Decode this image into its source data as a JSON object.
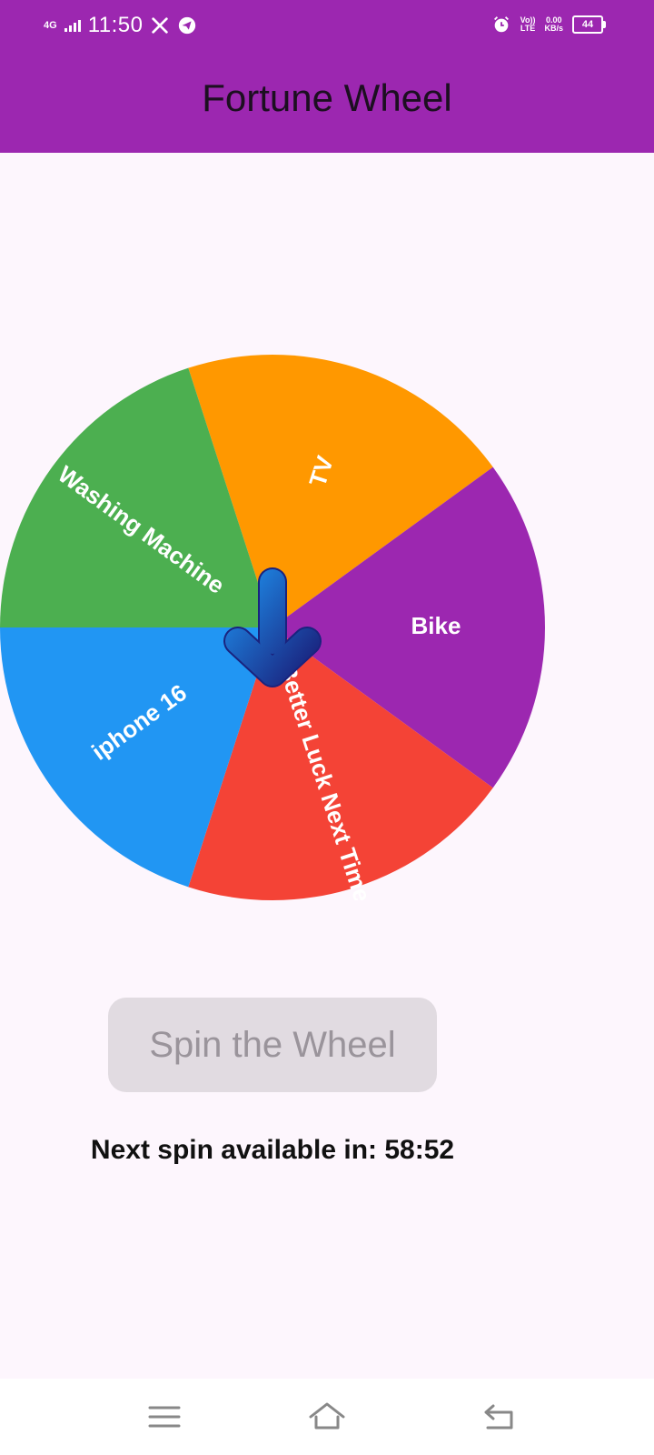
{
  "status_bar": {
    "network": "4G",
    "time": "11:50",
    "volte_top": "Vo))",
    "volte_bottom": "LTE",
    "speed_value": "0.00",
    "speed_unit": "KB/s",
    "battery": "44"
  },
  "app_bar": {
    "title": "Fortune Wheel"
  },
  "wheel": {
    "segments": [
      {
        "label": "TV",
        "color": "#ff9800"
      },
      {
        "label": "Bike",
        "color": "#9c27b0"
      },
      {
        "label": "Better Luck Next Time",
        "color": "#f44336"
      },
      {
        "label": "iphone 16",
        "color": "#2196f3"
      },
      {
        "label": "Washing Machine",
        "color": "#4caf50"
      }
    ],
    "pointer_icon": "arrow-down-icon"
  },
  "spin_button": {
    "label": "Spin the Wheel"
  },
  "timer": {
    "text": "Next spin available in: 58:52"
  },
  "nav_bar": {
    "icons": [
      "menu-icon",
      "home-icon",
      "back-icon"
    ]
  }
}
